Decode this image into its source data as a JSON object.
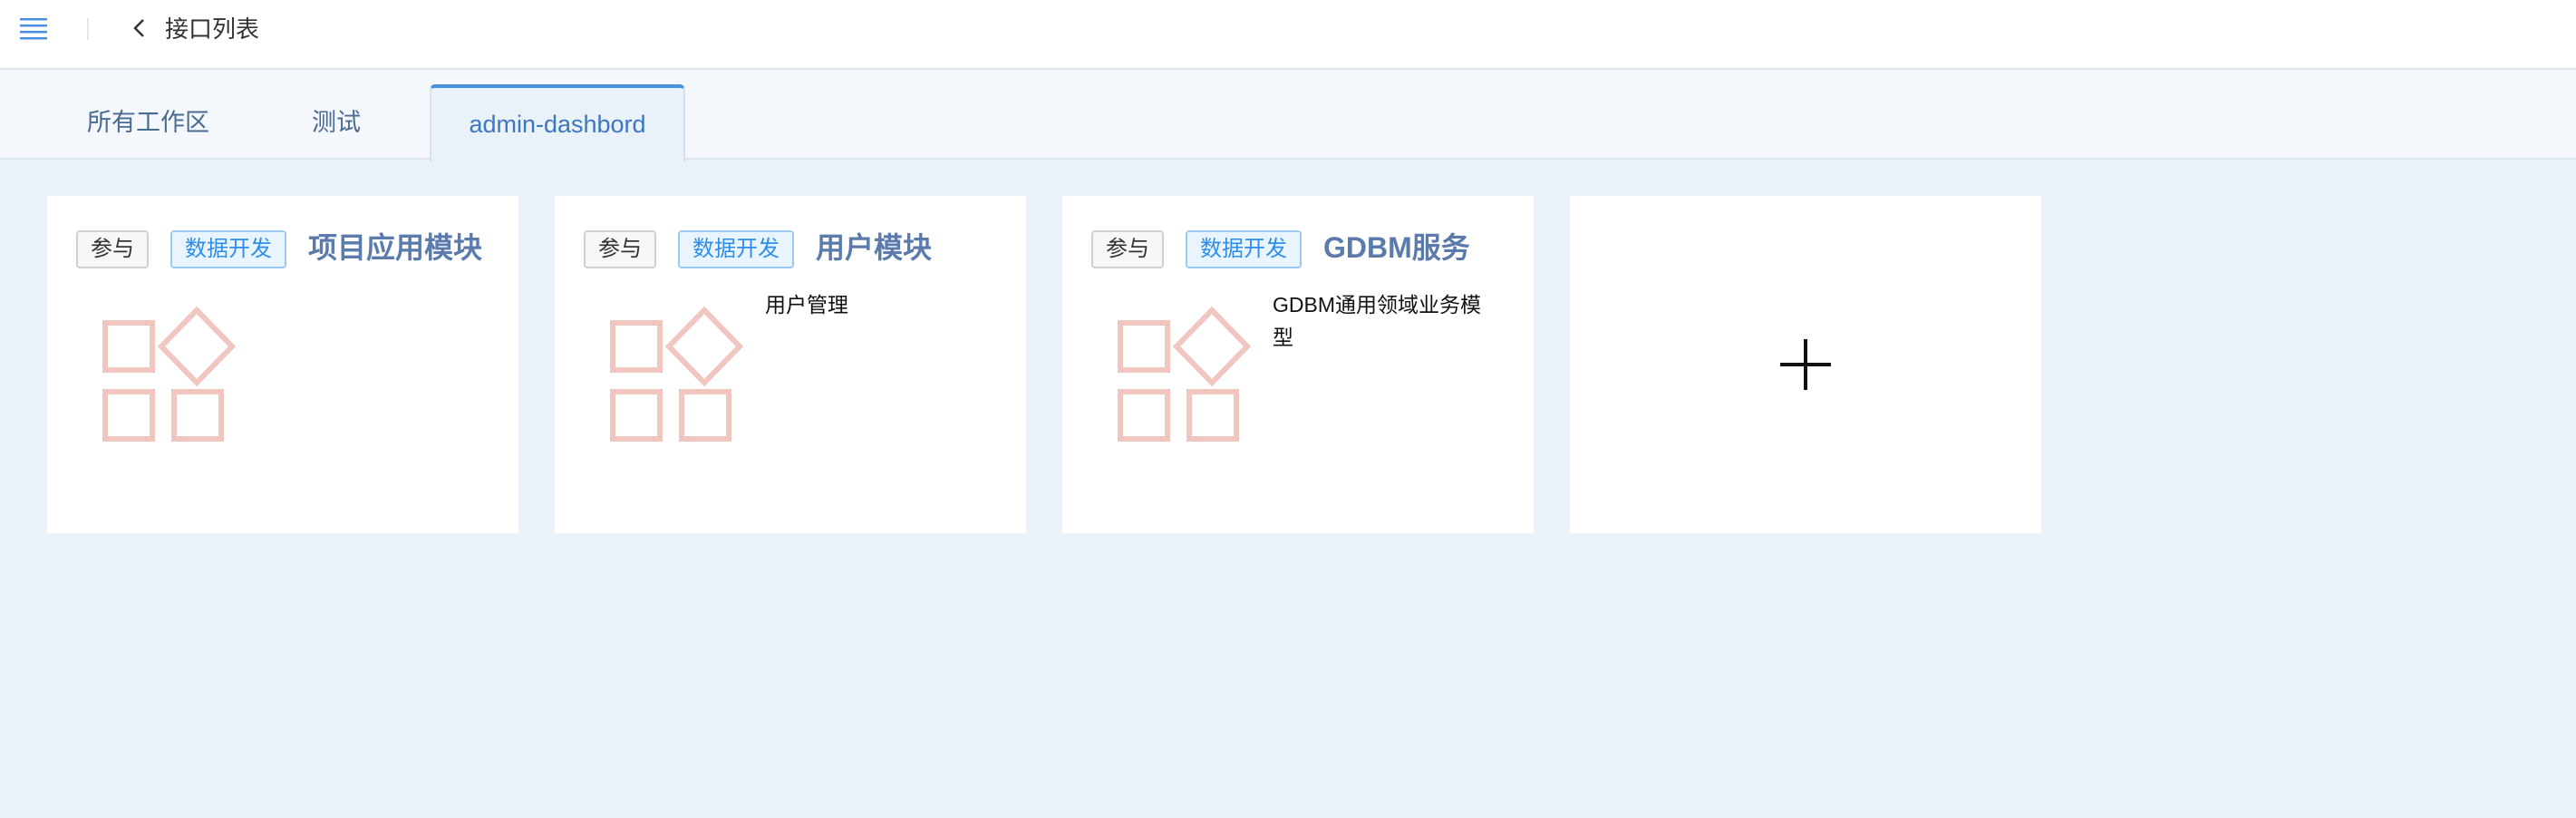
{
  "header": {
    "title": "接口列表",
    "icons": [
      "menu-icon",
      "chevron-left-icon"
    ]
  },
  "tabs": [
    {
      "label": "所有工作区",
      "active": false
    },
    {
      "label": "测试",
      "active": false
    },
    {
      "label": "admin-dashbord",
      "active": true
    }
  ],
  "cards": [
    {
      "role_tag": "参与",
      "category_tag": "数据开发",
      "title": "项目应用模块",
      "description": ""
    },
    {
      "role_tag": "参与",
      "category_tag": "数据开发",
      "title": "用户模块",
      "description": "用户管理"
    },
    {
      "role_tag": "参与",
      "category_tag": "数据开发",
      "title": "GDBM服务",
      "description": "GDBM通用领域业务模型"
    }
  ],
  "add_card": {
    "icon": "plus-icon"
  },
  "colors": {
    "accent": "#4a90e2",
    "card_title": "#5a7bab",
    "category_tag": "#2f8ee8",
    "module_icon": "#f2c6c0",
    "page_background": "#eaf1f9"
  }
}
